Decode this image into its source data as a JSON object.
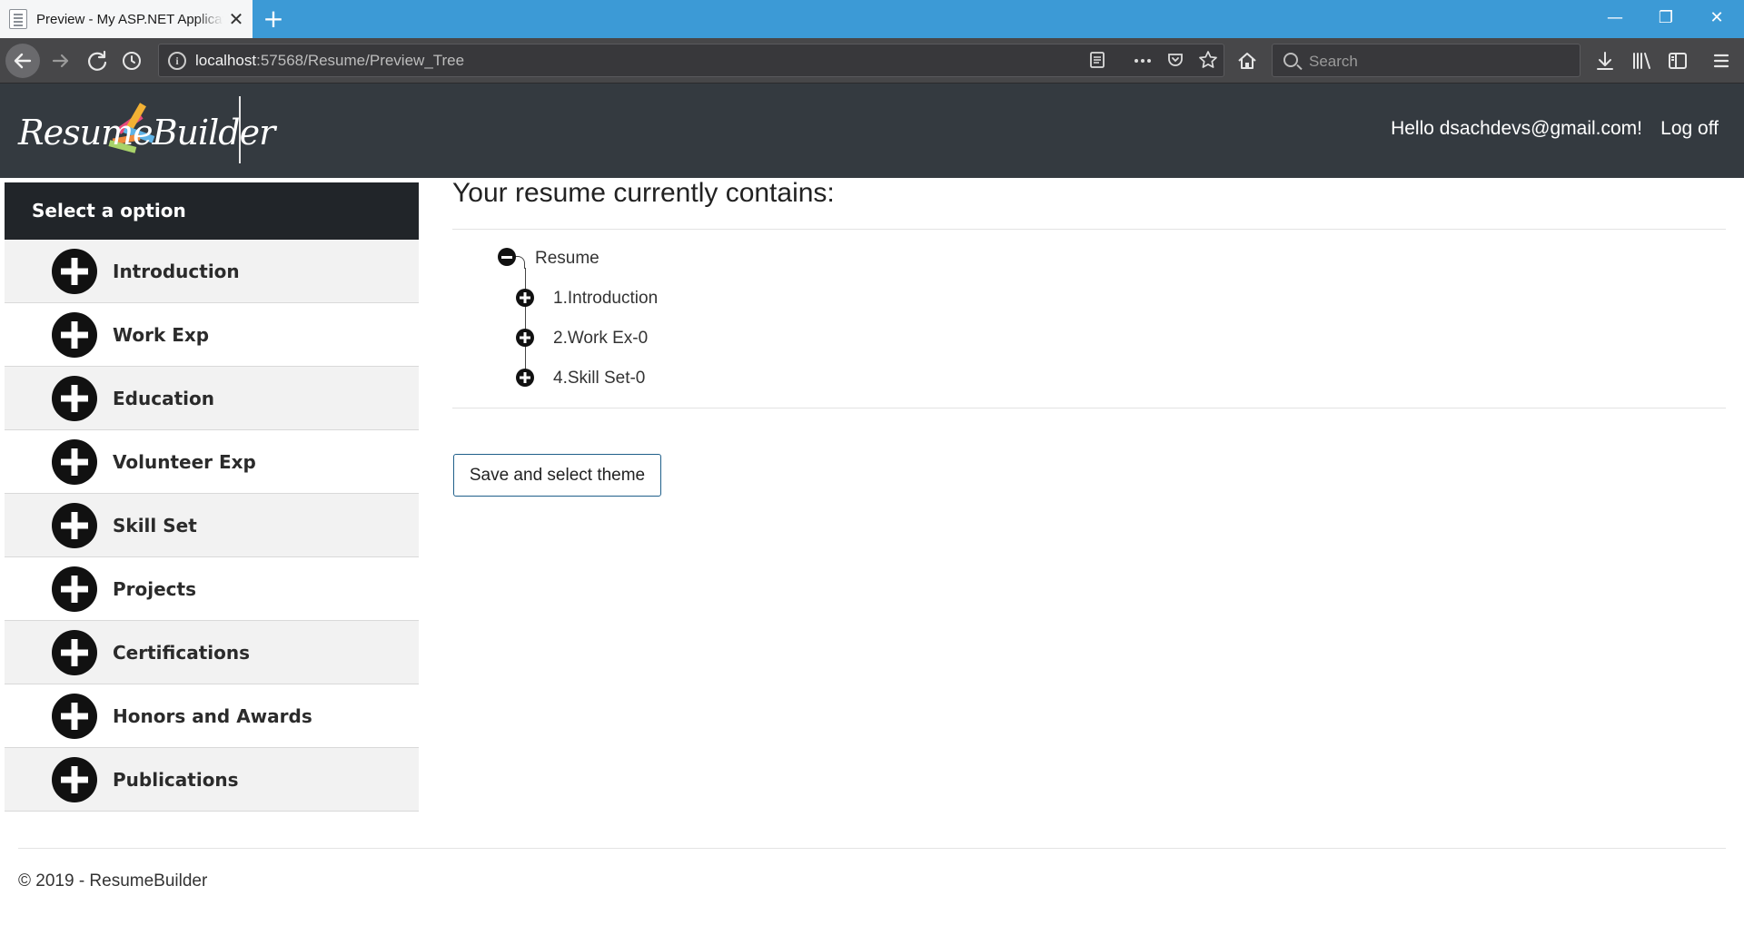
{
  "browser": {
    "tab_title": "Preview - My ASP.NET Application",
    "tab_close": "✕",
    "new_tab": "+",
    "window_controls": {
      "minimize": "—",
      "restore": "❐",
      "close": "✕"
    },
    "url_host": "localhost",
    "url_rest": ":57568/Resume/Preview_Tree",
    "search_placeholder": "Search",
    "info_glyph": "i"
  },
  "header": {
    "logo_text": "ResumeBuilder",
    "greeting": "Hello dsachdevs@gmail.com!",
    "logoff": "Log off"
  },
  "sidebar": {
    "heading": "Select a option",
    "items": [
      {
        "label": "Introduction"
      },
      {
        "label": "Work Exp"
      },
      {
        "label": "Education"
      },
      {
        "label": "Volunteer Exp"
      },
      {
        "label": "Skill Set"
      },
      {
        "label": "Projects"
      },
      {
        "label": "Certifications"
      },
      {
        "label": "Honors and Awards"
      },
      {
        "label": "Publications"
      }
    ]
  },
  "main": {
    "title": "Your resume currently contains:",
    "tree": {
      "root": "Resume",
      "children": [
        "1.Introduction",
        "2.Work Ex-0",
        "4.Skill Set-0"
      ]
    },
    "save_button": "Save and select theme"
  },
  "footer": {
    "text": "© 2019 - ResumeBuilder"
  }
}
